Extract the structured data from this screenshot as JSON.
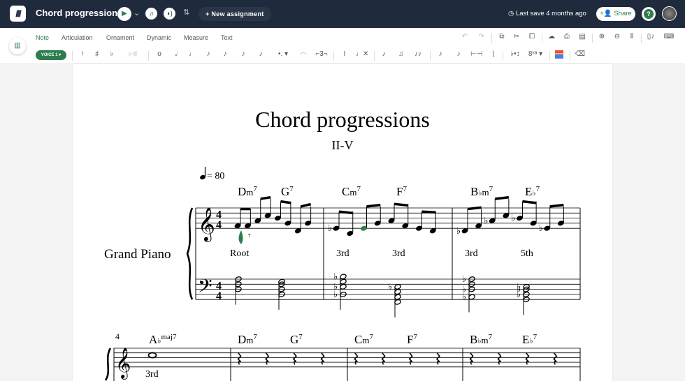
{
  "header": {
    "logo_icon": "flat-logo-icon",
    "title": "Chord progressions",
    "new_assignment": "New assignment",
    "last_save": "Last save 4 months ago",
    "share": "Share"
  },
  "toolbar": {
    "tabs": [
      "Note",
      "Articulation",
      "Ornament",
      "Dynamic",
      "Measure",
      "Text"
    ],
    "active_tab": "Note",
    "voice": "VOICE 1 ▾",
    "accent_color": "#2e7d4f"
  },
  "score": {
    "title": "Chord progressions",
    "subtitle": "II-V",
    "tempo": "= 80",
    "instrument": "Grand Piano",
    "time_signature": "4/4",
    "systems": [
      {
        "measures": [
          {
            "chords": [
              {
                "root": "D",
                "acc": "",
                "q": "m",
                "ext": "7"
              },
              {
                "root": "G",
                "acc": "",
                "q": "",
                "ext": "7"
              }
            ],
            "treble": [
              "F4",
              "F4",
              "A4",
              "C5",
              "B4",
              "G4",
              "D4",
              "G4"
            ],
            "green": [],
            "label": "Root",
            "bass": [
              [
                "D3",
                "F3",
                "A3"
              ],
              [
                "B2",
                "D3",
                "F3",
                "G3"
              ]
            ]
          },
          {
            "chords": [
              {
                "root": "C",
                "acc": "",
                "q": "m",
                "ext": "7"
              },
              {
                "root": "F",
                "acc": "",
                "q": "",
                "ext": "7"
              }
            ],
            "treble": [
              "Eb4",
              "C4",
              "E4",
              "G4",
              "A4",
              "F4",
              "E4",
              "D4"
            ],
            "green": [
              2
            ],
            "labels": [
              "3rd",
              "3rd"
            ],
            "bass": [
              [
                "Bb2",
                "Eb3",
                "G3",
                "Bb3"
              ],
              [
                "F2",
                "A2",
                "C3",
                "Eb3"
              ]
            ]
          },
          {
            "chords": [
              {
                "root": "B",
                "acc": "♭",
                "q": "m",
                "ext": "7"
              },
              {
                "root": "E",
                "acc": "♭",
                "q": "",
                "ext": "7"
              }
            ],
            "treble": [
              "Db4",
              "F4",
              "Ab4",
              "C5",
              "Bb4",
              "G4",
              "Eb4",
              "G4"
            ],
            "green": [],
            "labels": [
              "3rd",
              "5th"
            ],
            "bass": [
              [
                "Ab2",
                "Db3",
                "F3",
                "Ab3"
              ],
              [
                "G2",
                "Bb2",
                "Db3",
                "Eb3"
              ]
            ]
          }
        ]
      },
      {
        "measure_number": "4",
        "measures": [
          {
            "chords": [
              {
                "root": "A",
                "acc": "♭",
                "q": "",
                "ext": "maj7"
              }
            ],
            "whole": "C5",
            "labels": [
              "3rd"
            ]
          },
          {
            "chords": [
              {
                "root": "D",
                "acc": "",
                "q": "m",
                "ext": "7"
              },
              {
                "root": "G",
                "acc": "",
                "q": "",
                "ext": "7"
              }
            ],
            "rests": 4
          },
          {
            "chords": [
              {
                "root": "C",
                "acc": "",
                "q": "m",
                "ext": "7"
              },
              {
                "root": "F",
                "acc": "",
                "q": "",
                "ext": "7"
              }
            ],
            "rests": 4
          },
          {
            "chords": [
              {
                "root": "B",
                "acc": "♭",
                "q": "m",
                "ext": "7"
              },
              {
                "root": "E",
                "acc": "♭",
                "q": "",
                "ext": "7"
              }
            ],
            "rests": 4
          }
        ]
      }
    ]
  }
}
